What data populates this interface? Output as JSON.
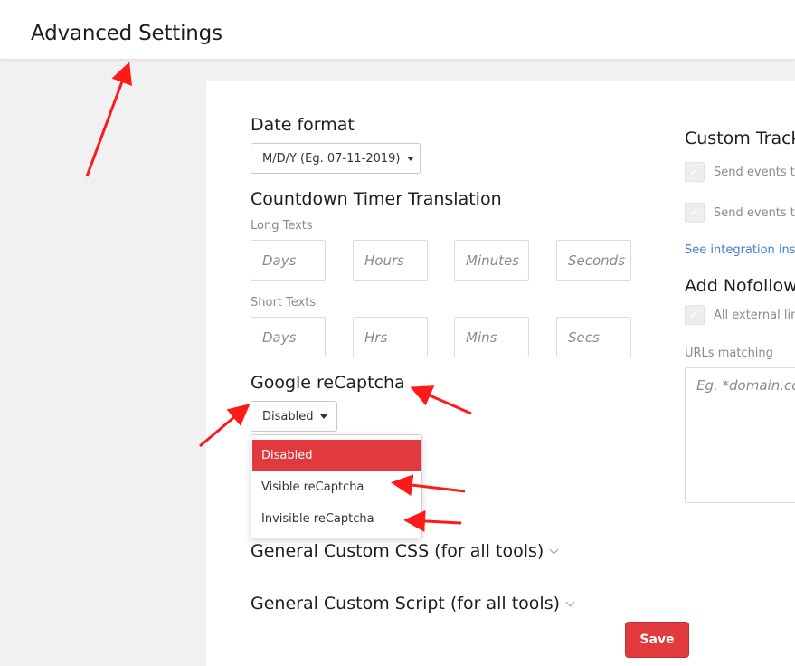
{
  "header": {
    "title": "Advanced Settings"
  },
  "date_format": {
    "title": "Date format",
    "selected": "M/D/Y (Eg. 07-11-2019)"
  },
  "countdown": {
    "title": "Countdown Timer Translation",
    "long_label": "Long Texts",
    "long_placeholders": [
      "Days",
      "Hours",
      "Minutes",
      "Seconds"
    ],
    "short_label": "Short Texts",
    "short_placeholders": [
      "Days",
      "Hrs",
      "Mins",
      "Secs"
    ]
  },
  "recaptcha": {
    "title": "Google reCaptcha",
    "selected": "Disabled",
    "options": [
      "Disabled",
      "Visible reCaptcha",
      "Invisible reCaptcha"
    ]
  },
  "custom_css": {
    "title": "General Custom CSS (for all tools)"
  },
  "custom_script": {
    "title": "General Custom Script (for all tools)"
  },
  "tracking": {
    "title": "Custom Track",
    "option1": "Send events t",
    "option2": "Send events t",
    "link": "See integration ins"
  },
  "nofollow": {
    "title": "Add Nofollow",
    "option": "All external lin",
    "urls_label": "URLs matching",
    "urls_placeholder": "Eg. *domain.co"
  },
  "save_label": "Save",
  "colors": {
    "accent": "#e03a3e",
    "link": "#3d7fd6",
    "annotation": "#ff1a1a"
  }
}
